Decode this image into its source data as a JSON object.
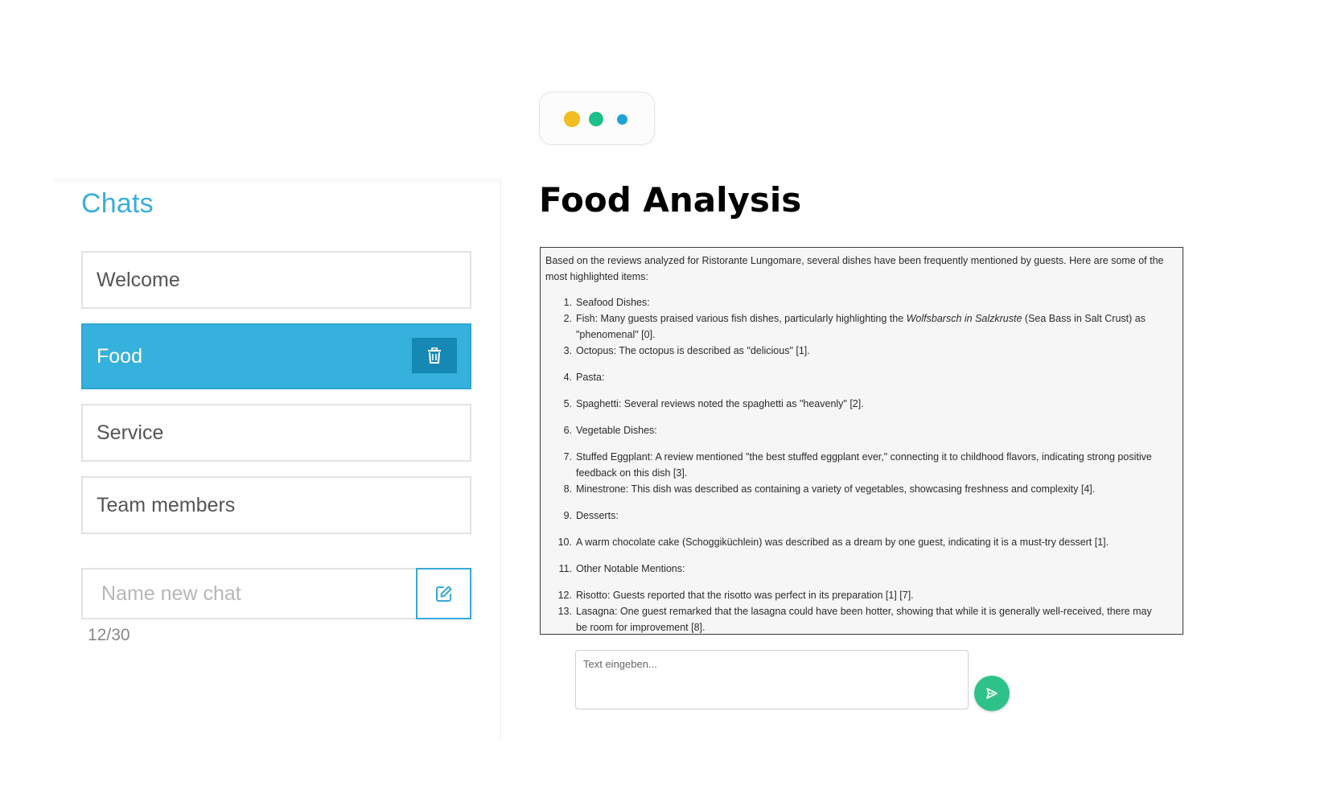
{
  "sidebar": {
    "title": "Chats",
    "items": [
      {
        "label": "Welcome"
      },
      {
        "label": "Food"
      },
      {
        "label": "Service"
      },
      {
        "label": "Team members"
      }
    ],
    "new_chat": {
      "placeholder": "Name new chat",
      "counter": "12/30"
    }
  },
  "main": {
    "title": "Food Analysis",
    "answer": {
      "intro": "Based on the reviews analyzed for Ristorante Lungomare, several dishes have been frequently mentioned by guests. Here are some of the most highlighted items:",
      "items": [
        {
          "num": "1.",
          "text": "Seafood Dishes:"
        },
        {
          "num": "2.",
          "text_before": "Fish: Many guests praised various fish dishes, particularly highlighting the ",
          "italic": "Wolfsbarsch in Salzkruste",
          "text_after": " (Sea Bass in Salt Crust) as \"phenomenal\" [0]."
        },
        {
          "num": "3.",
          "text": "Octopus: The octopus is described as \"delicious\" [1]."
        },
        {
          "num": "4.",
          "text": "Pasta:"
        },
        {
          "num": "5.",
          "text": "Spaghetti: Several reviews noted the spaghetti as \"heavenly\" [2]."
        },
        {
          "num": "6.",
          "text": "Vegetable Dishes:"
        },
        {
          "num": "7.",
          "text": "Stuffed Eggplant: A review mentioned \"the best stuffed eggplant ever,\" connecting it to childhood flavors, indicating strong positive feedback on this dish [3]."
        },
        {
          "num": "8.",
          "text": "Minestrone: This dish was described as containing a variety of vegetables, showcasing freshness and complexity [4]."
        },
        {
          "num": "9.",
          "text": "Desserts:"
        },
        {
          "num": "10.",
          "text": "A warm chocolate cake (Schoggiküchlein) was described as a dream by one guest, indicating it is a must-try dessert [1]."
        },
        {
          "num": "11.",
          "text": "Other Notable Mentions:"
        },
        {
          "num": "12.",
          "text": "Risotto: Guests reported that the risotto was perfect in its preparation [1] [7]."
        },
        {
          "num": "13.",
          "text": "Lasagna: One guest remarked that the lasagna could have been hotter, showing that while it is generally well-received, there may be room for improvement [8]."
        }
      ]
    },
    "input": {
      "placeholder": "Text eingeben..."
    }
  },
  "icons": {
    "typing": "typing-indicator-dots",
    "delete": "trash-icon",
    "edit": "edit-icon",
    "send": "send-icon"
  },
  "colors": {
    "accent": "#36b0dc",
    "accent_dark": "#1589b3",
    "send": "#2ec28a",
    "dot_yellow": "#f2bd1d",
    "dot_green": "#1ec08a",
    "dot_blue": "#1ea3d8"
  }
}
